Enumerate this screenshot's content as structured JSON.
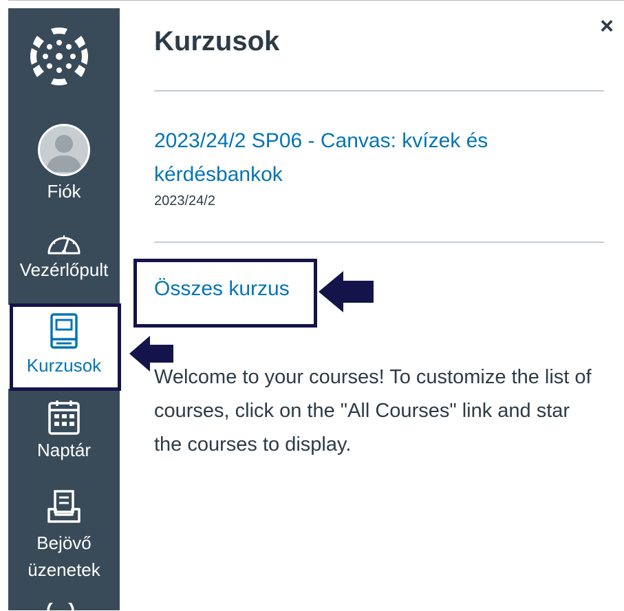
{
  "colors": {
    "sidebar_bg": "#394b58",
    "link": "#0374b5",
    "text": "#2d3b45",
    "annotation": "#14144a"
  },
  "nav": {
    "logo_icon": "canvas-logo-icon",
    "items": [
      {
        "icon": "avatar-icon",
        "label": "Fiók"
      },
      {
        "icon": "dashboard-gauge-icon",
        "label": "Vezérlőpult"
      },
      {
        "icon": "book-icon",
        "label": "Kurzusok"
      },
      {
        "icon": "calendar-icon",
        "label": "Naptár"
      },
      {
        "icon": "inbox-icon",
        "label": "Bejövő üzenetek"
      }
    ]
  },
  "tray": {
    "close_label": "×",
    "title": "Kurzusok",
    "course": {
      "name": "2023/24/2 SP06 - Canvas: kvízek és kérdésbankok",
      "term": "2023/24/2"
    },
    "all_courses_label": "Összes kurzus",
    "welcome_text": "Welcome to your courses! To customize the list of courses, click on the \"All Courses\" link and star the courses to display."
  }
}
